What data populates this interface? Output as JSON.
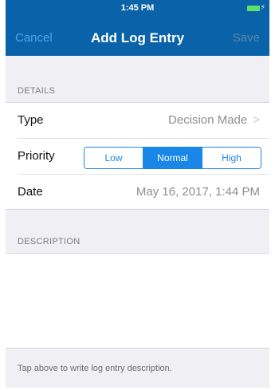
{
  "status_bar": {
    "time": "1:45 PM"
  },
  "nav": {
    "cancel_label": "Cancel",
    "title": "Add Log Entry",
    "save_label": "Save"
  },
  "details": {
    "header": "DETAILS",
    "type": {
      "label": "Type",
      "value": "Decision Made",
      "chevron": ">"
    },
    "priority": {
      "label": "Priority",
      "options": [
        "Low",
        "Normal",
        "High"
      ],
      "selected": "Normal"
    },
    "date": {
      "label": "Date",
      "value": "May 16, 2017, 1:44 PM"
    }
  },
  "description": {
    "header": "DESCRIPTION",
    "value": "",
    "hint": "Tap above to write log entry description."
  },
  "colors": {
    "nav_background": "#0a63a8",
    "accent": "#1a87e8",
    "battery": "#5ee06a"
  },
  "icons": [
    "battery-icon",
    "chevron-right-icon"
  ]
}
